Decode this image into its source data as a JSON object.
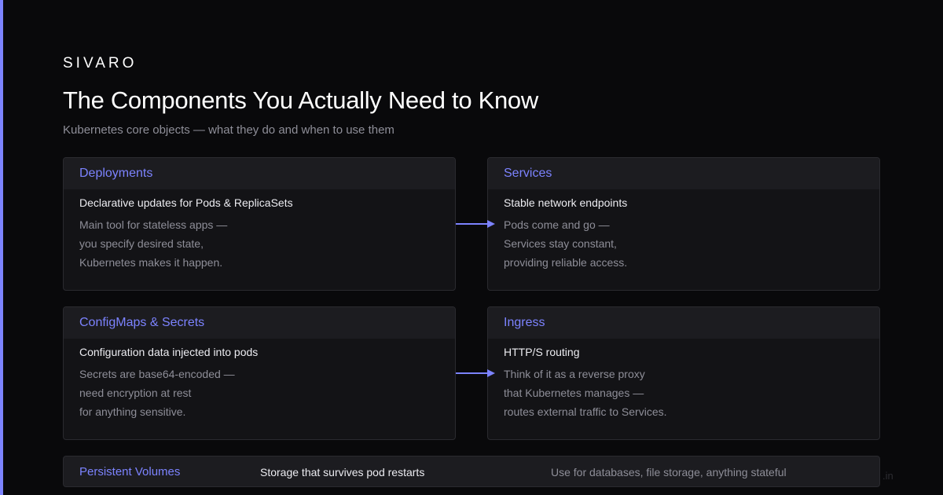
{
  "header": {
    "brand": "SIVARO",
    "title": "The Components You Actually Need to Know",
    "subtitle": "Kubernetes core objects — what they do and when to use them"
  },
  "cards": [
    {
      "title": "Deployments",
      "lead": "Declarative updates for Pods & ReplicaSets",
      "lines": [
        "Main tool for stateless apps —",
        "you specify desired state,",
        "Kubernetes makes it happen."
      ]
    },
    {
      "title": "Services",
      "lead": "Stable network endpoints",
      "lines": [
        "Pods come and go —",
        "Services stay constant,",
        "providing reliable access."
      ]
    },
    {
      "title": "ConfigMaps & Secrets",
      "lead": "Configuration data injected into pods",
      "lines": [
        "Secrets are base64-encoded —",
        "need encryption at rest",
        "for anything sensitive."
      ]
    },
    {
      "title": "Ingress",
      "lead": "HTTP/S routing",
      "lines": [
        "Think of it as a reverse proxy",
        "that Kubernetes manages —",
        "routes external traffic to Services."
      ]
    }
  ],
  "persistent_volumes": {
    "title": "Persistent Volumes",
    "lead": "Storage that survives pod restarts",
    "note": "Use for databases, file storage, anything stateful"
  },
  "watermark": ".in",
  "colors": {
    "background": "#09090b",
    "accent": "#7c83ff",
    "card": "#131316",
    "card_header": "#1c1c20",
    "border": "#2a2a2f",
    "text_primary": "#ececf1",
    "text_muted": "#8e8e98"
  }
}
